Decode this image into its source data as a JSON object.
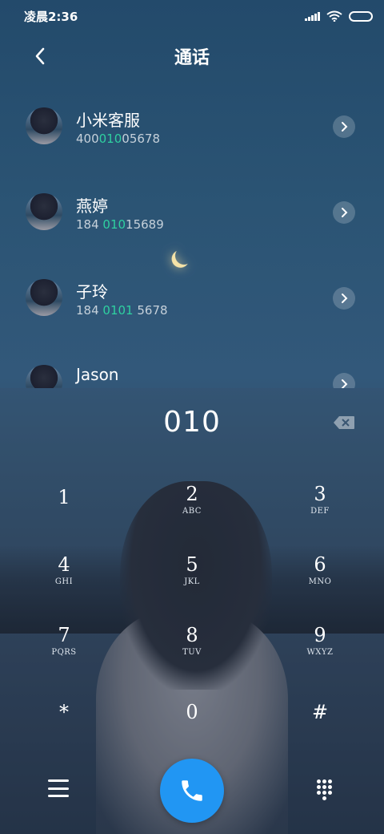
{
  "status_bar": {
    "time": "凌晨2:36"
  },
  "header": {
    "title": "通话"
  },
  "contacts": [
    {
      "name": "小米客服",
      "number_pre": "400",
      "number_hl": "010",
      "number_post": "05678"
    },
    {
      "name": "燕婷",
      "number_pre": "184 ",
      "number_hl": "010",
      "number_post": "15689"
    },
    {
      "name": "子玲",
      "number_pre": "184 ",
      "number_hl": "0101",
      "number_post": " 5678"
    },
    {
      "name": "Jason",
      "number_pre": "",
      "number_hl": "",
      "number_post": ""
    }
  ],
  "dialer": {
    "entered_number": "010",
    "keys": [
      {
        "digit": "1",
        "letters": ""
      },
      {
        "digit": "2",
        "letters": "ABC"
      },
      {
        "digit": "3",
        "letters": "DEF"
      },
      {
        "digit": "4",
        "letters": "GHI"
      },
      {
        "digit": "5",
        "letters": "JKL"
      },
      {
        "digit": "6",
        "letters": "MNO"
      },
      {
        "digit": "7",
        "letters": "PQRS"
      },
      {
        "digit": "8",
        "letters": "TUV"
      },
      {
        "digit": "9",
        "letters": "WXYZ"
      },
      {
        "digit": "*",
        "letters": ""
      },
      {
        "digit": "0",
        "letters": ""
      },
      {
        "digit": "#",
        "letters": ""
      }
    ]
  },
  "colors": {
    "highlight": "#2fd0a0",
    "call_button": "#2196f3"
  },
  "icons": {
    "back": "chevron-left-icon",
    "detail": "chevron-right-icon",
    "backspace": "backspace-icon",
    "menu": "menu-icon",
    "call": "phone-icon",
    "keypad": "dialpad-icon"
  }
}
